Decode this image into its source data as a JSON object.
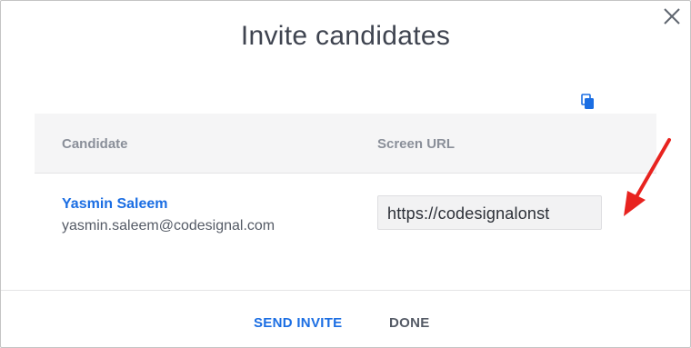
{
  "dialog": {
    "title": "Invite candidates",
    "close_icon": "close-icon"
  },
  "table": {
    "headers": {
      "candidate": "Candidate",
      "screen_url": "Screen URL"
    },
    "rows": [
      {
        "name": "Yasmin Saleem",
        "email": "yasmin.saleem@codesignal.com",
        "url": "https://codesignalonst",
        "copy_icon": "copy-icon"
      }
    ]
  },
  "footer": {
    "send_invite": "SEND INVITE",
    "done": "DONE"
  },
  "annotation": {
    "arrow_color": "#e8231f",
    "icon": "red-arrow-icon"
  },
  "colors": {
    "accent": "#1b6ee3",
    "header_bg": "#f5f5f6",
    "text_dark": "#3f4450",
    "text_muted": "#8a8f99"
  }
}
